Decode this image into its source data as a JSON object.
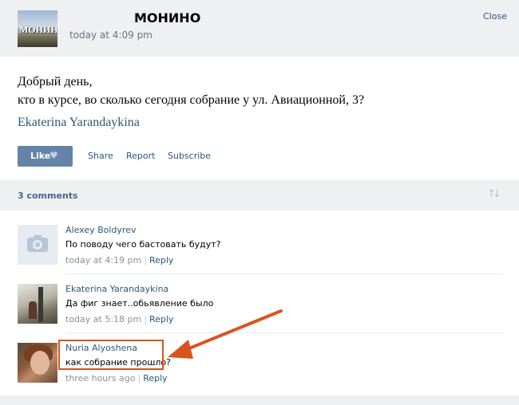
{
  "header": {
    "group_title": "МОНИНО",
    "group_logo_text": "МОНИНО",
    "time": "today at 4:09 pm",
    "close_label": "Close"
  },
  "post": {
    "text_line1": "Добрый день,",
    "text_line2": "кто в курсе, во сколько сегодня собрание у ул. Авиационной, 3?",
    "author": "Ekaterina Yarandaykina",
    "like_label": "Like",
    "like_icon": "heart-icon",
    "actions": [
      "Share",
      "Report",
      "Subscribe"
    ]
  },
  "comments_header": {
    "count_label": "3 comments",
    "sort_icon": "sort-arrows-icon"
  },
  "comments": [
    {
      "author": "Alexey Boldyrev",
      "text": "По поводу чего бастовать будут?",
      "time": "today at 4:19 pm",
      "reply": "Reply",
      "avatar": "camera-placeholder-icon"
    },
    {
      "author": "Ekaterina Yarandaykina",
      "text": "Да фиг знает..обьявление было",
      "time": "today at 5:18 pm",
      "reply": "Reply",
      "avatar": "user-photo"
    },
    {
      "author": "Nuria Alyoshena",
      "text": "как собрание прошло?",
      "time": "three hours ago",
      "reply": "Reply",
      "avatar": "user-photo"
    }
  ],
  "colors": {
    "link": "#2b587a",
    "like_button": "#6483a8",
    "header_bg": "#eff0f2",
    "annotation": "#d9541c"
  }
}
